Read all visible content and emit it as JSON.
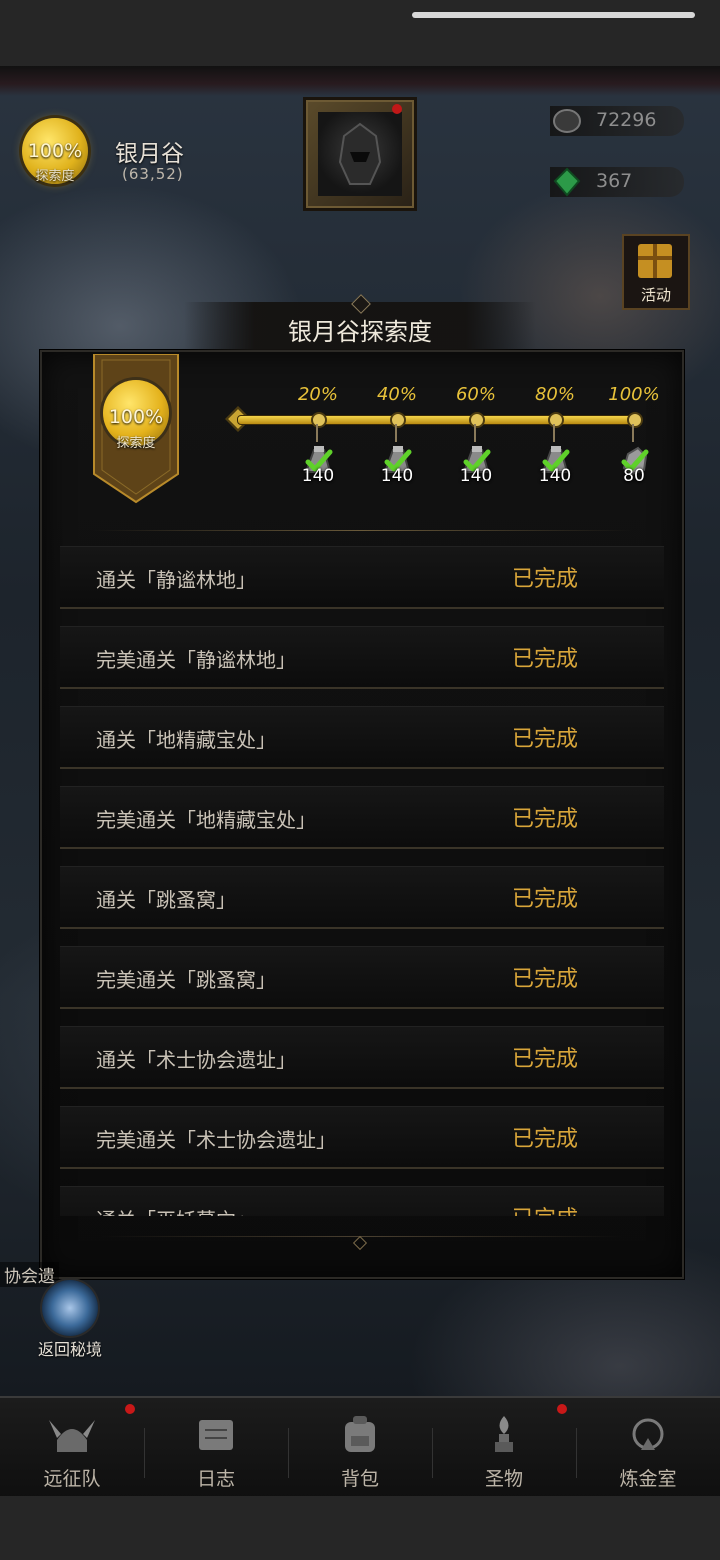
{
  "location": {
    "percent": "100%",
    "percent_label": "探索度",
    "name": "银月谷",
    "coords": "(63,52)"
  },
  "resources": [
    {
      "icon": "ore-icon",
      "value": "72296"
    },
    {
      "icon": "green-gem-icon",
      "value": "367"
    }
  ],
  "activity": {
    "label": "活动",
    "icon": "gift-box-icon"
  },
  "modal": {
    "title": "银月谷探索度",
    "banner_percent": "100%",
    "banner_label": "探索度",
    "milestones": [
      {
        "percent": "20%",
        "count": "140",
        "reward_icon": "gear-part-icon",
        "claimed": true
      },
      {
        "percent": "40%",
        "count": "140",
        "reward_icon": "gear-part-icon",
        "claimed": true
      },
      {
        "percent": "60%",
        "count": "140",
        "reward_icon": "gear-part-icon",
        "claimed": true
      },
      {
        "percent": "80%",
        "count": "140",
        "reward_icon": "gear-part-icon",
        "claimed": true
      },
      {
        "percent": "100%",
        "count": "80",
        "reward_icon": "ore-chunk-icon",
        "claimed": true
      }
    ],
    "tasks": [
      {
        "label": "通关「静谧林地」",
        "status": "已完成"
      },
      {
        "label": "完美通关「静谧林地」",
        "status": "已完成"
      },
      {
        "label": "通关「地精藏宝处」",
        "status": "已完成"
      },
      {
        "label": "完美通关「地精藏宝处」",
        "status": "已完成"
      },
      {
        "label": "通关「跳蚤窝」",
        "status": "已完成"
      },
      {
        "label": "完美通关「跳蚤窝」",
        "status": "已完成"
      },
      {
        "label": "通关「术士协会遗址」",
        "status": "已完成"
      },
      {
        "label": "完美通关「术士协会遗址」",
        "status": "已完成"
      },
      {
        "label": "通关「巫妖墓穴」",
        "status": "已完成"
      }
    ]
  },
  "map": {
    "return_portal_label": "返回秘境",
    "side_label": "协会遗"
  },
  "nav": {
    "items": [
      {
        "label": "远征队",
        "icon": "viking-helmet-icon",
        "badge": true
      },
      {
        "label": "日志",
        "icon": "scroll-icon",
        "badge": false
      },
      {
        "label": "背包",
        "icon": "backpack-icon",
        "badge": false
      },
      {
        "label": "圣物",
        "icon": "torch-relic-icon",
        "badge": true
      },
      {
        "label": "炼金室",
        "icon": "alchemy-icon",
        "badge": false
      }
    ]
  },
  "colors": {
    "accent_gold": "#d9a63a",
    "badge_red": "#c81818",
    "check_green": "#5fd12a"
  }
}
